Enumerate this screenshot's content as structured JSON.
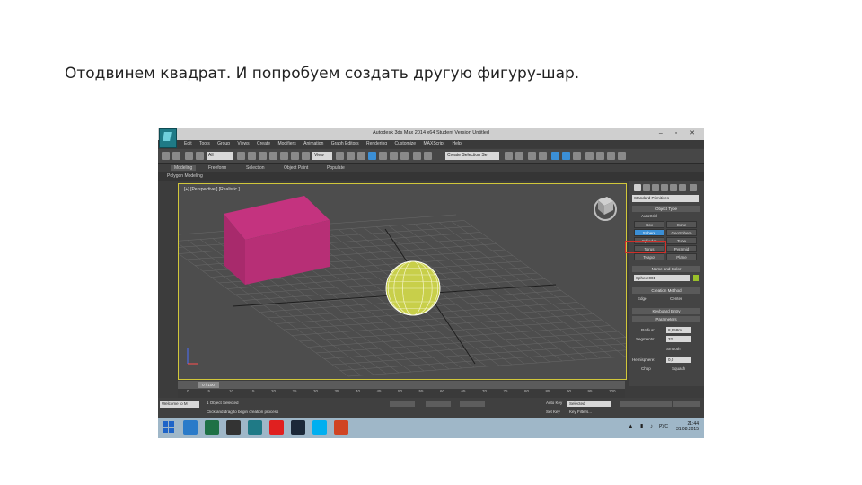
{
  "caption": "Отодвинем квадрат. И попробуем создать другую фигуру-шар.",
  "window": {
    "title": "Autodesk 3ds Max 2014 x64    Student Version    Untitled",
    "controls": "–  ▫  ✕"
  },
  "menu": [
    "Edit",
    "Tools",
    "Group",
    "Views",
    "Create",
    "Modifiers",
    "Animation",
    "Graph Editors",
    "Rendering",
    "Customize",
    "MAXScript",
    "Help"
  ],
  "toolbar": {
    "filter_select": "All",
    "view_select": "View",
    "named_sets": "Create Selection Se"
  },
  "ribbon": {
    "tabs": [
      "Modeling",
      "Freeform",
      "Selection",
      "Object Paint",
      "Populate"
    ],
    "sub": "Polygon Modeling"
  },
  "viewport": {
    "label": "[+] [Perspective ] [Realistic ]"
  },
  "command_panel": {
    "category": "Standard Primitives",
    "object_type_header": "Object Type",
    "autogrid": "AutoGrid",
    "buttons": [
      "Box",
      "Cone",
      "Sphere",
      "GeoSphere",
      "Cylinder",
      "Tube",
      "Torus",
      "Pyramid",
      "Teapot",
      "Plane"
    ],
    "selected_button": "Sphere",
    "name_color_header": "Name and Color",
    "object_name": "Sphere001",
    "creation_method_header": "Creation Method",
    "creation_methods": [
      "Edge",
      "Center"
    ],
    "keyboard_entry_header": "Keyboard Entry",
    "parameters_header": "Parameters",
    "radius_label": "Radius:",
    "radius_value": "8,958m",
    "segments_label": "Segments:",
    "segments_value": "32",
    "smooth_label": "Smooth",
    "hemisphere_label": "Hemisphere:",
    "hemisphere_value": "0,0",
    "chop_label": "Chop",
    "squash_label": "Squash"
  },
  "time_slider": {
    "value": "0 / 100"
  },
  "track_ticks": [
    "0",
    "5",
    "10",
    "15",
    "20",
    "25",
    "30",
    "35",
    "40",
    "45",
    "50",
    "55",
    "60",
    "65",
    "70",
    "75",
    "80",
    "85",
    "90",
    "95",
    "100"
  ],
  "status": {
    "left_box": "Welcome to M",
    "line1": "1 Object Selected",
    "line2": "Click and drag to begin creation process",
    "autokey": "Auto Key",
    "selected": "Selected",
    "set_key": "Set Key",
    "key_filters": "Key Filters..."
  },
  "taskbar": {
    "lang": "РУС",
    "time": "21:44",
    "date": "31.08.2015",
    "colors": {
      "outlook": "#2a7bc9",
      "excel": "#1e7145",
      "terminal": "#333333",
      "max": "#1f7a86",
      "yandex": "#e02020",
      "steam": "#1b2838",
      "skype": "#00aff0",
      "powerpoint": "#d04423"
    }
  }
}
